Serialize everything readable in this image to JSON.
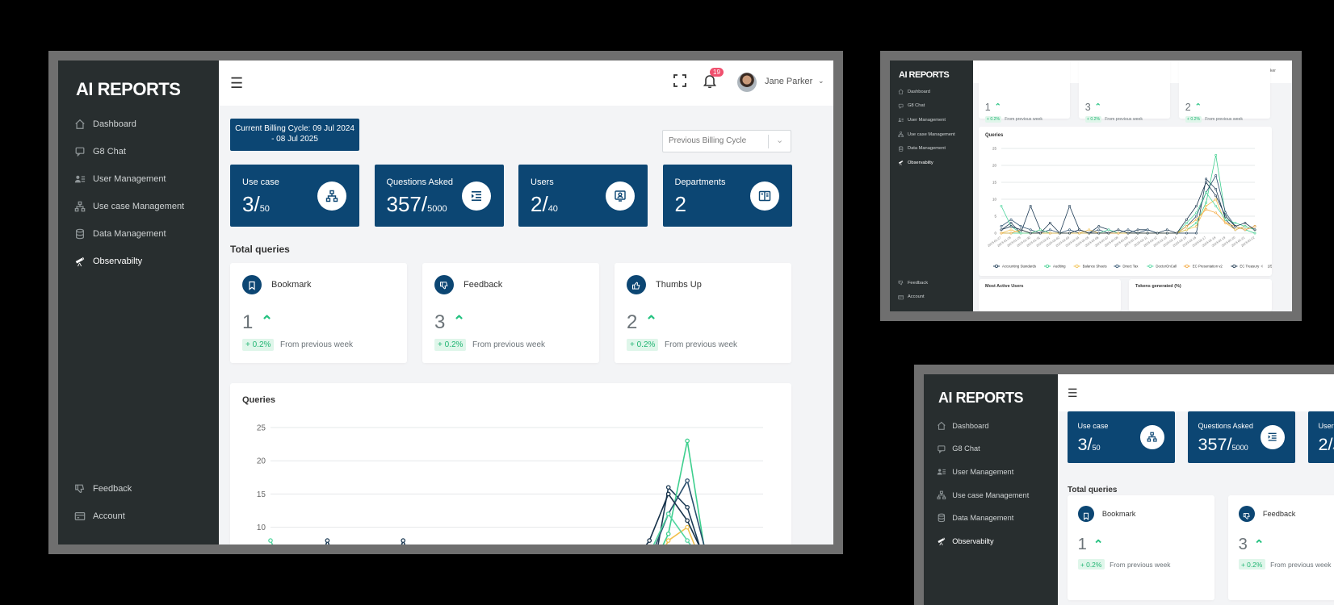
{
  "app": {
    "brand": "AI REPORTS"
  },
  "sidebar": {
    "items": [
      {
        "label": "Dashboard",
        "icon": "home-icon"
      },
      {
        "label": "G8 Chat",
        "icon": "chat-icon"
      },
      {
        "label": "User Management",
        "icon": "users-icon"
      },
      {
        "label": "Use case Management",
        "icon": "hierarchy-icon"
      },
      {
        "label": "Data Management",
        "icon": "database-icon"
      },
      {
        "label": "Observabilty",
        "icon": "telescope-icon"
      }
    ],
    "bottom": [
      {
        "label": "Feedback",
        "icon": "thumbs-down-icon"
      },
      {
        "label": "Account",
        "icon": "card-icon"
      }
    ]
  },
  "topbar": {
    "notifications": "19",
    "user_name": "Jane Parker"
  },
  "billing": {
    "current": "Current Billing Cycle: 09 Jul 2024 - 08 Jul 2025",
    "select_placeholder": "Previous Billing Cycle"
  },
  "kpis": [
    {
      "label": "Use case",
      "value": "3/",
      "total": "50",
      "icon": "hierarchy-icon"
    },
    {
      "label": "Questions Asked",
      "value": "357/",
      "total": "5000",
      "icon": "list-indent-icon"
    },
    {
      "label": "Users",
      "value": "2/",
      "total": "40",
      "icon": "user-badge-icon"
    },
    {
      "label": "Departments",
      "value": "2",
      "total": "",
      "icon": "book-icon"
    }
  ],
  "total_queries": {
    "title": "Total queries",
    "cards": [
      {
        "label": "Bookmark",
        "value": "1",
        "change": "+ 0.2%",
        "note": "From previous week",
        "icon": "bookmark-icon"
      },
      {
        "label": "Feedback",
        "value": "3",
        "change": "+ 0.2%",
        "note": "From previous week",
        "icon": "thumbs-down-icon"
      },
      {
        "label": "Thumbs Up",
        "value": "2",
        "change": "+ 0.2%",
        "note": "From previous week",
        "icon": "thumbs-up-icon"
      }
    ]
  },
  "queries_chart": {
    "title": "Queries"
  },
  "chart_data": {
    "type": "line",
    "title": "Queries",
    "ylim": [
      0,
      25
    ],
    "yticks": [
      0,
      5,
      10,
      15,
      20,
      25
    ],
    "x": [
      "2023-01-27",
      "2023-01-28",
      "2023-01-29",
      "2023-01-30",
      "2023-01-31",
      "2023-02-01",
      "2023-02-02",
      "2023-02-03",
      "2023-02-04",
      "2023-02-05",
      "2023-02-06",
      "2023-02-07",
      "2023-02-08",
      "2023-02-09",
      "2023-02-10",
      "2023-02-11",
      "2023-02-12",
      "2023-02-13",
      "2023-02-14",
      "2023-02-15",
      "2023-02-16",
      "2023-02-17",
      "2023-02-18",
      "2023-02-19",
      "2023-02-20",
      "2023-02-21",
      "2023-02-22"
    ],
    "series": [
      {
        "name": "Accounting Standards",
        "color": "#1d3b55",
        "values": [
          1,
          3,
          0,
          8,
          1,
          0,
          0,
          8,
          1,
          0,
          2,
          1,
          0,
          0,
          1,
          1,
          0,
          1,
          0,
          0,
          0,
          16,
          13,
          4,
          1,
          2,
          1
        ]
      },
      {
        "name": "Auditing",
        "color": "#3ecf8e",
        "values": [
          0,
          0,
          0,
          0,
          0,
          0,
          0,
          0,
          0,
          0,
          0,
          0,
          0,
          0,
          0,
          0,
          0,
          0,
          0,
          1,
          3,
          9,
          23,
          5,
          2,
          1,
          0
        ]
      },
      {
        "name": "Balance Sheets",
        "color": "#f2c14e",
        "values": [
          0,
          1,
          0,
          0,
          1,
          0,
          0,
          0,
          0,
          1,
          0,
          0,
          0,
          0,
          0,
          0,
          0,
          0,
          0,
          1,
          2,
          8,
          10,
          3,
          1,
          2,
          1
        ]
      },
      {
        "name": "Direct Tax",
        "color": "#2b4f6e",
        "values": [
          2,
          4,
          2,
          1,
          0,
          1,
          0,
          1,
          0,
          0,
          1,
          0,
          0,
          1,
          0,
          1,
          0,
          0,
          0,
          2,
          5,
          12,
          17,
          6,
          2,
          1,
          2
        ]
      },
      {
        "name": "DoctorOnCall",
        "color": "#52d6a0",
        "values": [
          8,
          2,
          0,
          0,
          1,
          0,
          0,
          0,
          0,
          0,
          0,
          1,
          0,
          0,
          0,
          0,
          0,
          0,
          0,
          3,
          6,
          12,
          8,
          4,
          3,
          2,
          1
        ]
      },
      {
        "name": "EC Presentation v2",
        "color": "#f4a940",
        "values": [
          0,
          0,
          1,
          0,
          0,
          0,
          0,
          0,
          0,
          0,
          0,
          0,
          0,
          0,
          0,
          0,
          0,
          0,
          0,
          2,
          4,
          7,
          6,
          3,
          2,
          1,
          2
        ]
      },
      {
        "name": "EC Treasury",
        "color": "#17324a",
        "values": [
          1,
          2,
          1,
          0,
          0,
          3,
          0,
          0,
          1,
          0,
          0,
          0,
          1,
          0,
          0,
          0,
          0,
          0,
          0,
          4,
          8,
          15,
          11,
          5,
          2,
          3,
          1
        ]
      }
    ],
    "legend_page": "1/5"
  },
  "bottom_cards": {
    "most_active": "Most Active Users",
    "tokens": "Tokens generated (%)"
  }
}
